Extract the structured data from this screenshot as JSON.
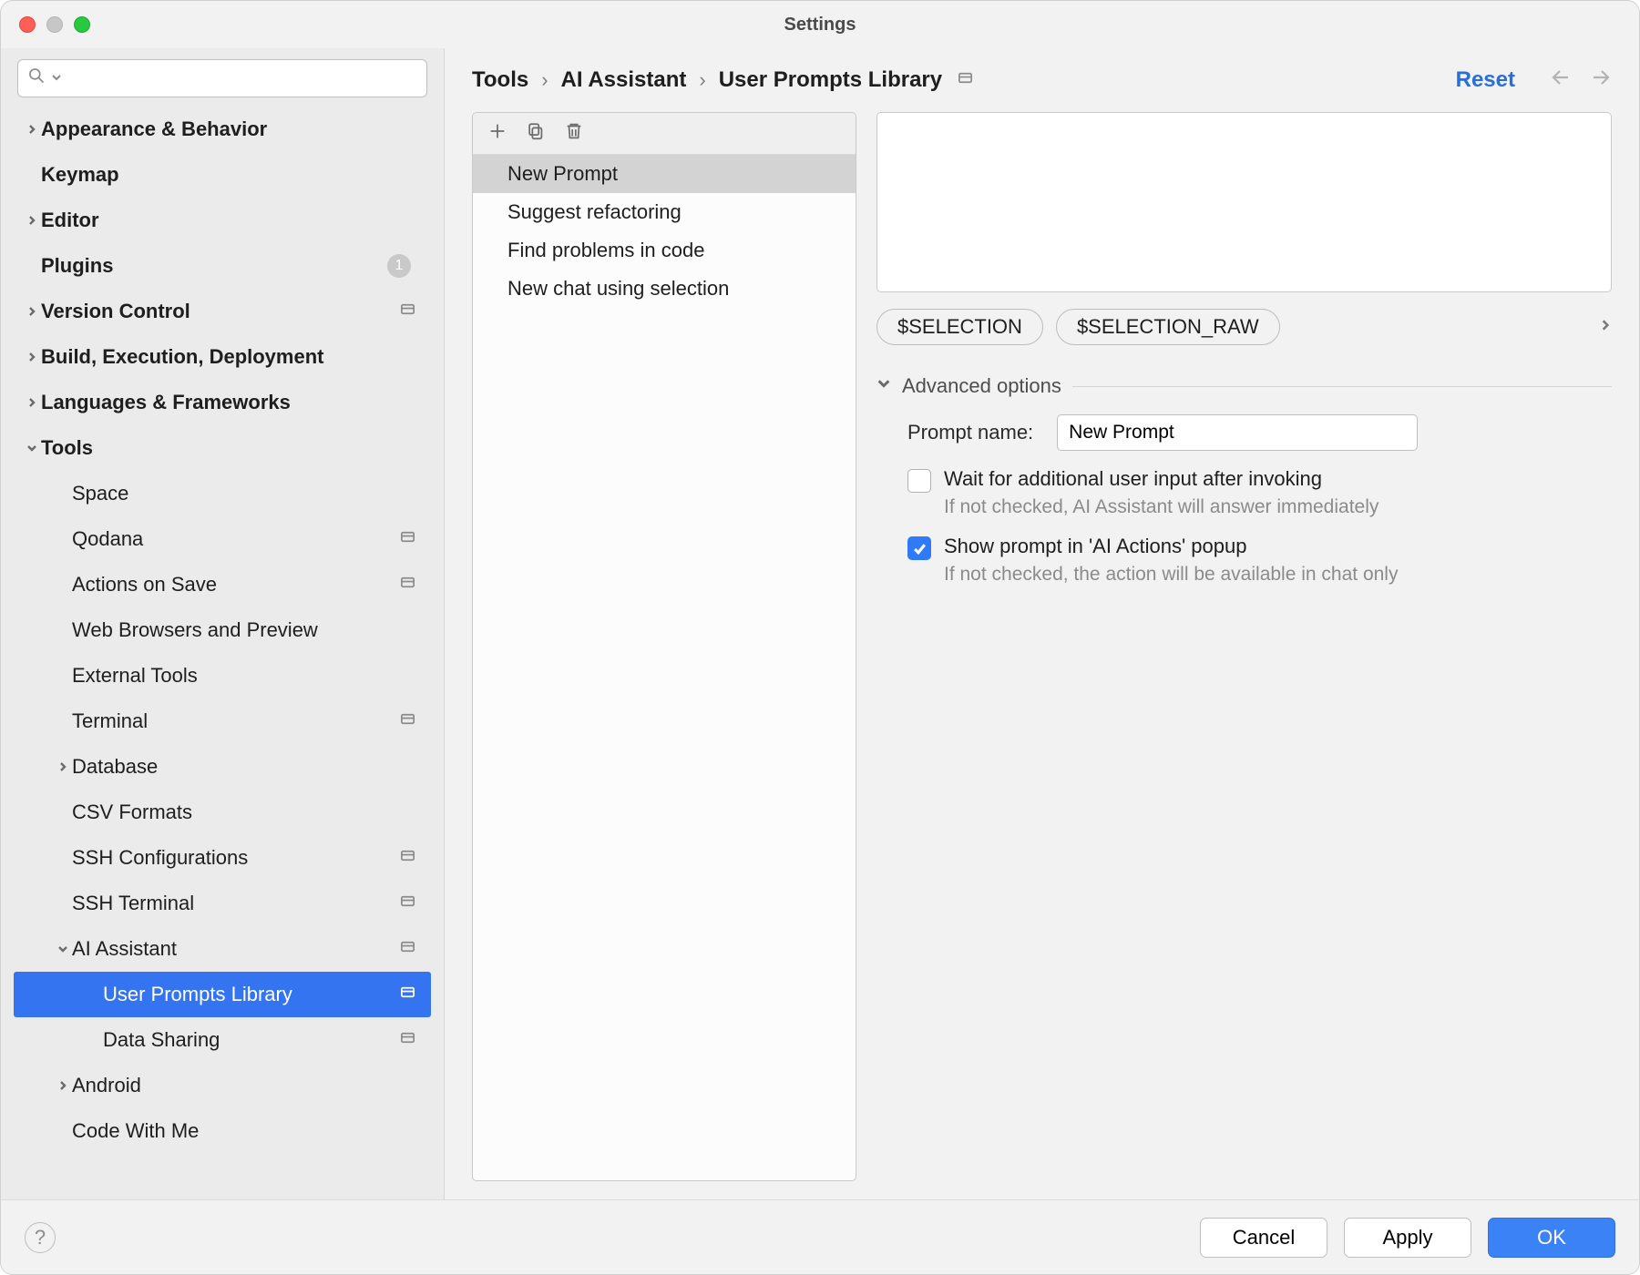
{
  "window": {
    "title": "Settings"
  },
  "sidebar": {
    "items": [
      {
        "label": "Appearance & Behavior",
        "expandable": true,
        "expanded": false,
        "level": 0,
        "top": true
      },
      {
        "label": "Keymap",
        "expandable": false,
        "level": 0,
        "top": true
      },
      {
        "label": "Editor",
        "expandable": true,
        "expanded": false,
        "level": 0,
        "top": true
      },
      {
        "label": "Plugins",
        "expandable": false,
        "level": 0,
        "top": true,
        "badge": "1"
      },
      {
        "label": "Version Control",
        "expandable": true,
        "expanded": false,
        "level": 0,
        "top": true,
        "group_icon": true
      },
      {
        "label": "Build, Execution, Deployment",
        "expandable": true,
        "expanded": false,
        "level": 0,
        "top": true
      },
      {
        "label": "Languages & Frameworks",
        "expandable": true,
        "expanded": false,
        "level": 0,
        "top": true
      },
      {
        "label": "Tools",
        "expandable": true,
        "expanded": true,
        "level": 0,
        "top": true
      },
      {
        "label": "Space",
        "expandable": false,
        "level": 1
      },
      {
        "label": "Qodana",
        "expandable": false,
        "level": 1,
        "group_icon": true
      },
      {
        "label": "Actions on Save",
        "expandable": false,
        "level": 1,
        "group_icon": true
      },
      {
        "label": "Web Browsers and Preview",
        "expandable": false,
        "level": 1
      },
      {
        "label": "External Tools",
        "expandable": false,
        "level": 1
      },
      {
        "label": "Terminal",
        "expandable": false,
        "level": 1,
        "group_icon": true
      },
      {
        "label": "Database",
        "expandable": true,
        "expanded": false,
        "level": 1
      },
      {
        "label": "CSV Formats",
        "expandable": false,
        "level": 1
      },
      {
        "label": "SSH Configurations",
        "expandable": false,
        "level": 1,
        "group_icon": true
      },
      {
        "label": "SSH Terminal",
        "expandable": false,
        "level": 1,
        "group_icon": true
      },
      {
        "label": "AI Assistant",
        "expandable": true,
        "expanded": true,
        "level": 1,
        "group_icon": true
      },
      {
        "label": "User Prompts Library",
        "expandable": false,
        "level": 2,
        "group_icon": true,
        "selected": true
      },
      {
        "label": "Data Sharing",
        "expandable": false,
        "level": 2,
        "group_icon": true
      },
      {
        "label": "Android",
        "expandable": true,
        "expanded": false,
        "level": 1
      },
      {
        "label": "Code With Me",
        "expandable": false,
        "level": 1
      }
    ]
  },
  "breadcrumbs": {
    "a": "Tools",
    "b": "AI Assistant",
    "c": "User Prompts Library"
  },
  "reset_label": "Reset",
  "prompt_list": {
    "items": [
      {
        "label": "New Prompt",
        "selected": true
      },
      {
        "label": "Suggest refactoring"
      },
      {
        "label": "Find problems in code"
      },
      {
        "label": "New chat using selection"
      }
    ]
  },
  "chips": {
    "a": "$SELECTION",
    "b": "$SELECTION_RAW"
  },
  "advanced": {
    "heading": "Advanced options",
    "prompt_name_label": "Prompt name:",
    "prompt_name_value": "New Prompt",
    "wait_label": "Wait for additional user input after invoking",
    "wait_hint": "If not checked, AI Assistant will answer immediately",
    "show_label": "Show prompt in 'AI Actions' popup",
    "show_hint": "If not checked, the action will be available in chat only"
  },
  "footer": {
    "cancel": "Cancel",
    "apply": "Apply",
    "ok": "OK"
  }
}
